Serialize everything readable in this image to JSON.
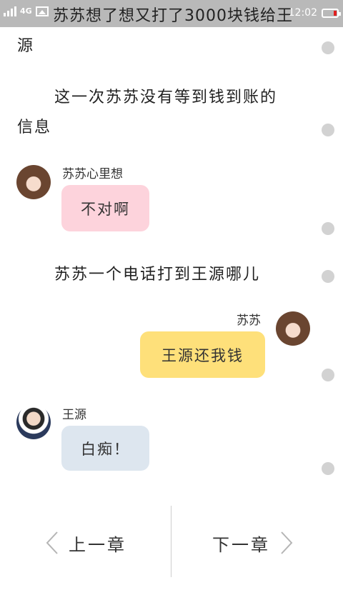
{
  "status_bar": {
    "network": "4G",
    "time": "12:02",
    "icons": [
      "signal-icon",
      "gallery-icon",
      "battery-icon"
    ]
  },
  "story": {
    "line_top": "苏苏想了想又打了3000块钱给王",
    "line_top_cont": "源",
    "para1_a": "这一次苏苏没有等到钱到账的",
    "para1_b": "信息",
    "para2": "苏苏一个电话打到王源哪儿"
  },
  "chat": [
    {
      "speaker": "苏苏心里想",
      "text": "不对啊",
      "side": "left",
      "bubble_color": "#fdd3dc"
    },
    {
      "speaker": "苏苏",
      "text": "王源还我钱",
      "side": "right",
      "bubble_color": "#fee07a"
    },
    {
      "speaker": "王源",
      "text": "白痴！",
      "side": "left",
      "bubble_color": "#dde6ef"
    }
  ],
  "nav": {
    "prev_label": "上一章",
    "next_label": "下一章"
  },
  "colors": {
    "status_bar": "#b9b9b9",
    "rail_dot": "#d2d2d2",
    "battery_low": "#e02020"
  }
}
